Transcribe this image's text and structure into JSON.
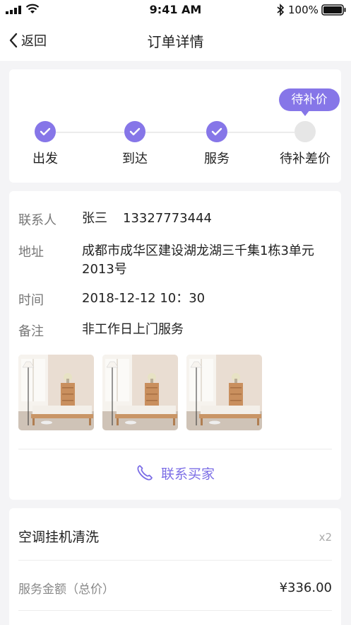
{
  "status_bar": {
    "time": "9:41 AM",
    "battery": "100%"
  },
  "nav": {
    "back_label": "返回",
    "title": "订单详情"
  },
  "progress": {
    "bubble": "待补价",
    "steps": [
      {
        "label": "出发",
        "done": true
      },
      {
        "label": "到达",
        "done": true
      },
      {
        "label": "服务",
        "done": true
      },
      {
        "label": "待补差价",
        "done": false
      }
    ]
  },
  "info": {
    "contact_label": "联系人",
    "contact_name": "张三",
    "contact_phone": "13327773444",
    "address_label": "地址",
    "address_line1": "成都市成华区建设湖龙湖三千集1栋3单元",
    "address_line2": "2013号",
    "time_label": "时间",
    "time_value": "2018-12-12 10：30",
    "note_label": "备注",
    "note_value": "非工作日上门服务",
    "contact_buyer": "联系买家"
  },
  "service": {
    "name": "空调挂机清洗",
    "qty": "x2",
    "amount_label": "服务金额（总价）",
    "amount": "¥336.00"
  },
  "colors": {
    "accent": "#8676e8",
    "pending": "#e6e6e6"
  },
  "icons": [
    "chevron-left-icon",
    "check-icon",
    "phone-icon",
    "wifi-icon",
    "bluetooth-icon",
    "battery-icon",
    "signal-icon"
  ]
}
